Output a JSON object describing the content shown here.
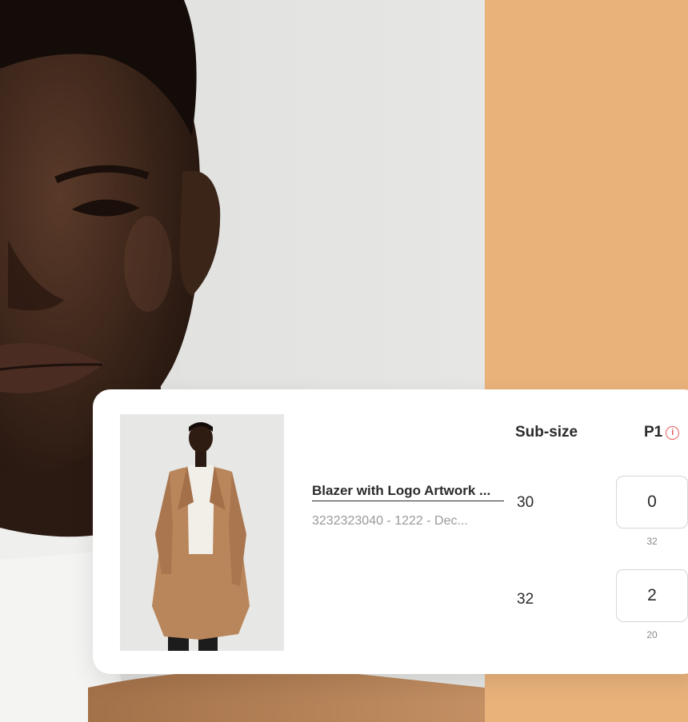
{
  "colors": {
    "accent_panel": "#e9b27b",
    "card_background": "#ffffff",
    "info_icon": "#e45b5b",
    "coat": "#b9855a"
  },
  "product": {
    "name": "Blazer with Logo Artwork ...",
    "meta": "3232323040 - 1222 - Dec..."
  },
  "table": {
    "header_subsize": "Sub-size",
    "header_p1": "P1",
    "rows": [
      {
        "subsize": "30",
        "quantity": "0",
        "available": "32"
      },
      {
        "subsize": "32",
        "quantity": "2",
        "available": "20"
      }
    ]
  },
  "icons": {
    "p1_info": "info-circle-icon",
    "p1_info_glyph": "i"
  }
}
